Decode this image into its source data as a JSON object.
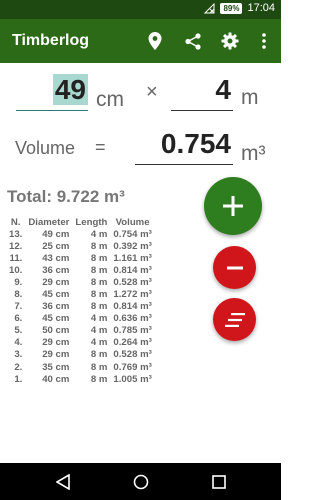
{
  "status": {
    "battery": "89%",
    "time": "17:04"
  },
  "app": {
    "title": "Timberlog"
  },
  "toolbar": {
    "icons": [
      "location-icon",
      "share-icon",
      "settings-icon",
      "more-vert-icon"
    ]
  },
  "input": {
    "diameter": "49",
    "diameter_unit": "cm",
    "times": "×",
    "length": "4",
    "length_unit": "m"
  },
  "volume": {
    "label": "Volume",
    "equals": "=",
    "value": "0.754",
    "unit": "m³"
  },
  "total": "Total: 9.722 m³",
  "table": {
    "headers": [
      "N.",
      "Diameter",
      "Length",
      "Volume"
    ],
    "rows": [
      [
        "13.",
        "49 cm",
        "4 m",
        "0.754 m³"
      ],
      [
        "12.",
        "25 cm",
        "8 m",
        "0.392 m³"
      ],
      [
        "11.",
        "43 cm",
        "8 m",
        "1.161 m³"
      ],
      [
        "10.",
        "36 cm",
        "8 m",
        "0.814 m³"
      ],
      [
        "9.",
        "29 cm",
        "8 m",
        "0.528 m³"
      ],
      [
        "8.",
        "45 cm",
        "8 m",
        "1.272 m³"
      ],
      [
        "7.",
        "36 cm",
        "8 m",
        "0.814 m³"
      ],
      [
        "6.",
        "45 cm",
        "4 m",
        "0.636 m³"
      ],
      [
        "5.",
        "50 cm",
        "4 m",
        "0.785 m³"
      ],
      [
        "4.",
        "29 cm",
        "4 m",
        "0.264 m³"
      ],
      [
        "3.",
        "29 cm",
        "8 m",
        "0.528 m³"
      ],
      [
        "2.",
        "35 cm",
        "8 m",
        "0.769 m³"
      ],
      [
        "1.",
        "40 cm",
        "8 m",
        "1.005 m³"
      ]
    ]
  },
  "colors": {
    "appbar": "#2d6a18",
    "statusbar": "#1e4a11",
    "add_button": "#2e7d1f",
    "remove_button": "#d0161b",
    "highlight": "#a8d8d0"
  }
}
